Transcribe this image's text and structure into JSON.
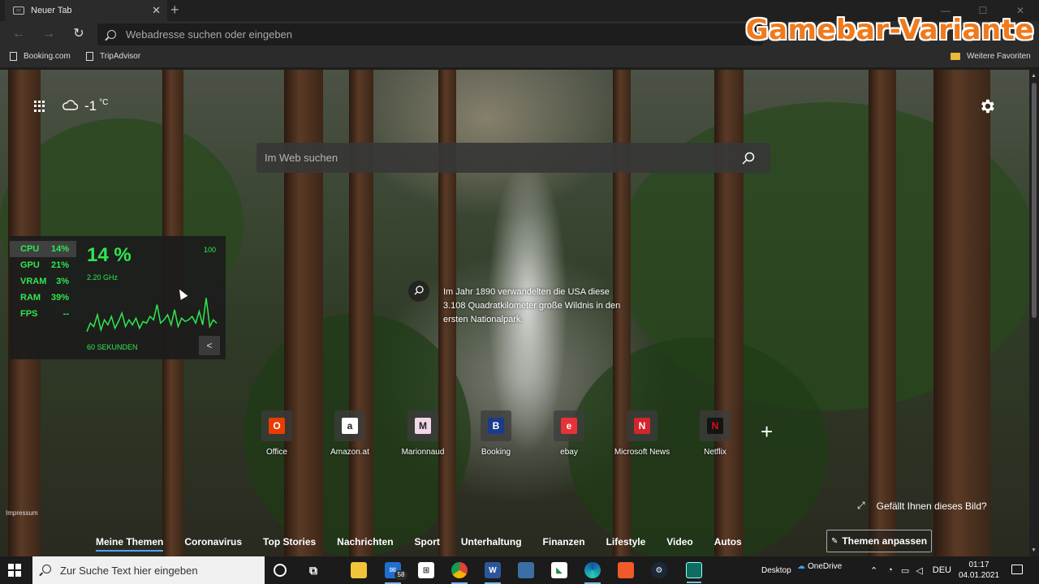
{
  "browser": {
    "tab_title": "Neuer Tab",
    "tab_favicon": "new-tab-icon",
    "tab_close": "✕",
    "new_tab": "+",
    "address_placeholder": "Webadresse suchen oder eingeben",
    "favorites": [
      {
        "label": "Booking.com",
        "icon": "document-icon"
      },
      {
        "label": "TripAdvisor",
        "icon": "document-icon"
      }
    ],
    "other_favorites": "Weitere Favoriten"
  },
  "overlay_brand": "Gamebar-Variante",
  "ntp": {
    "weather": {
      "temperature": "-1",
      "unit": "°C",
      "icon": "cloud-icon"
    },
    "search_placeholder": "Im Web suchen",
    "image_info": "Im Jahr 1890 verwandelten die USA diese 3.108 Quadratkilometer große Wildnis in den ersten Nationalpark.",
    "tiles": [
      {
        "label": "Office",
        "icon": "office-icon",
        "color": "#eb3c00",
        "glyph": "O"
      },
      {
        "label": "Amazon.at",
        "icon": "amazon-icon",
        "color": "#ffffff",
        "glyph": "a"
      },
      {
        "label": "Marionnaud",
        "icon": "marionnaud-icon",
        "color": "#f3d6ea",
        "glyph": "M"
      },
      {
        "label": "Booking",
        "icon": "booking-icon",
        "color": "#1b3b8a",
        "glyph": "B"
      },
      {
        "label": "ebay",
        "icon": "ebay-icon",
        "color": "#e53238",
        "glyph": "e"
      },
      {
        "label": "Microsoft News",
        "icon": "news-icon",
        "color": "#d3242b",
        "glyph": "N"
      },
      {
        "label": "Netflix",
        "icon": "netflix-icon",
        "color": "#141414",
        "glyph": "N"
      }
    ],
    "add_tile": "+",
    "impressum": "Impressum",
    "like_picture": "Gefällt Ihnen dieses Bild?",
    "news_tabs": [
      "Meine Themen",
      "Coronavirus",
      "Top Stories",
      "Nachrichten",
      "Sport",
      "Unterhaltung",
      "Finanzen",
      "Lifestyle",
      "Video",
      "Autos"
    ],
    "personalize": "Themen anpassen"
  },
  "perf_widget": {
    "metrics": [
      {
        "name": "CPU",
        "value": "14%"
      },
      {
        "name": "GPU",
        "value": "21%"
      },
      {
        "name": "VRAM",
        "value": "3%"
      },
      {
        "name": "RAM",
        "value": "39%"
      },
      {
        "name": "FPS",
        "value": "--"
      }
    ],
    "big_value": "14 %",
    "max_label": "100",
    "clock": "2.20 GHz",
    "window_label": "60 SEKUNDEN",
    "graph_color": "#2fe84f",
    "graph_values": [
      4,
      14,
      10,
      24,
      6,
      18,
      12,
      22,
      8,
      16,
      26,
      10,
      18,
      12,
      20,
      8,
      16,
      14,
      22,
      18,
      36,
      14,
      18,
      24,
      12,
      30,
      10,
      20,
      16,
      18,
      22,
      14,
      28,
      12,
      44,
      10,
      18,
      14
    ]
  },
  "taskbar": {
    "search_placeholder": "Zur Suche Text hier eingeben",
    "mail_badge": "58",
    "desktop_label": "Desktop",
    "onedrive_label": "OneDrive",
    "language": "DEU",
    "time": "01:17",
    "date": "04.01.2021"
  }
}
